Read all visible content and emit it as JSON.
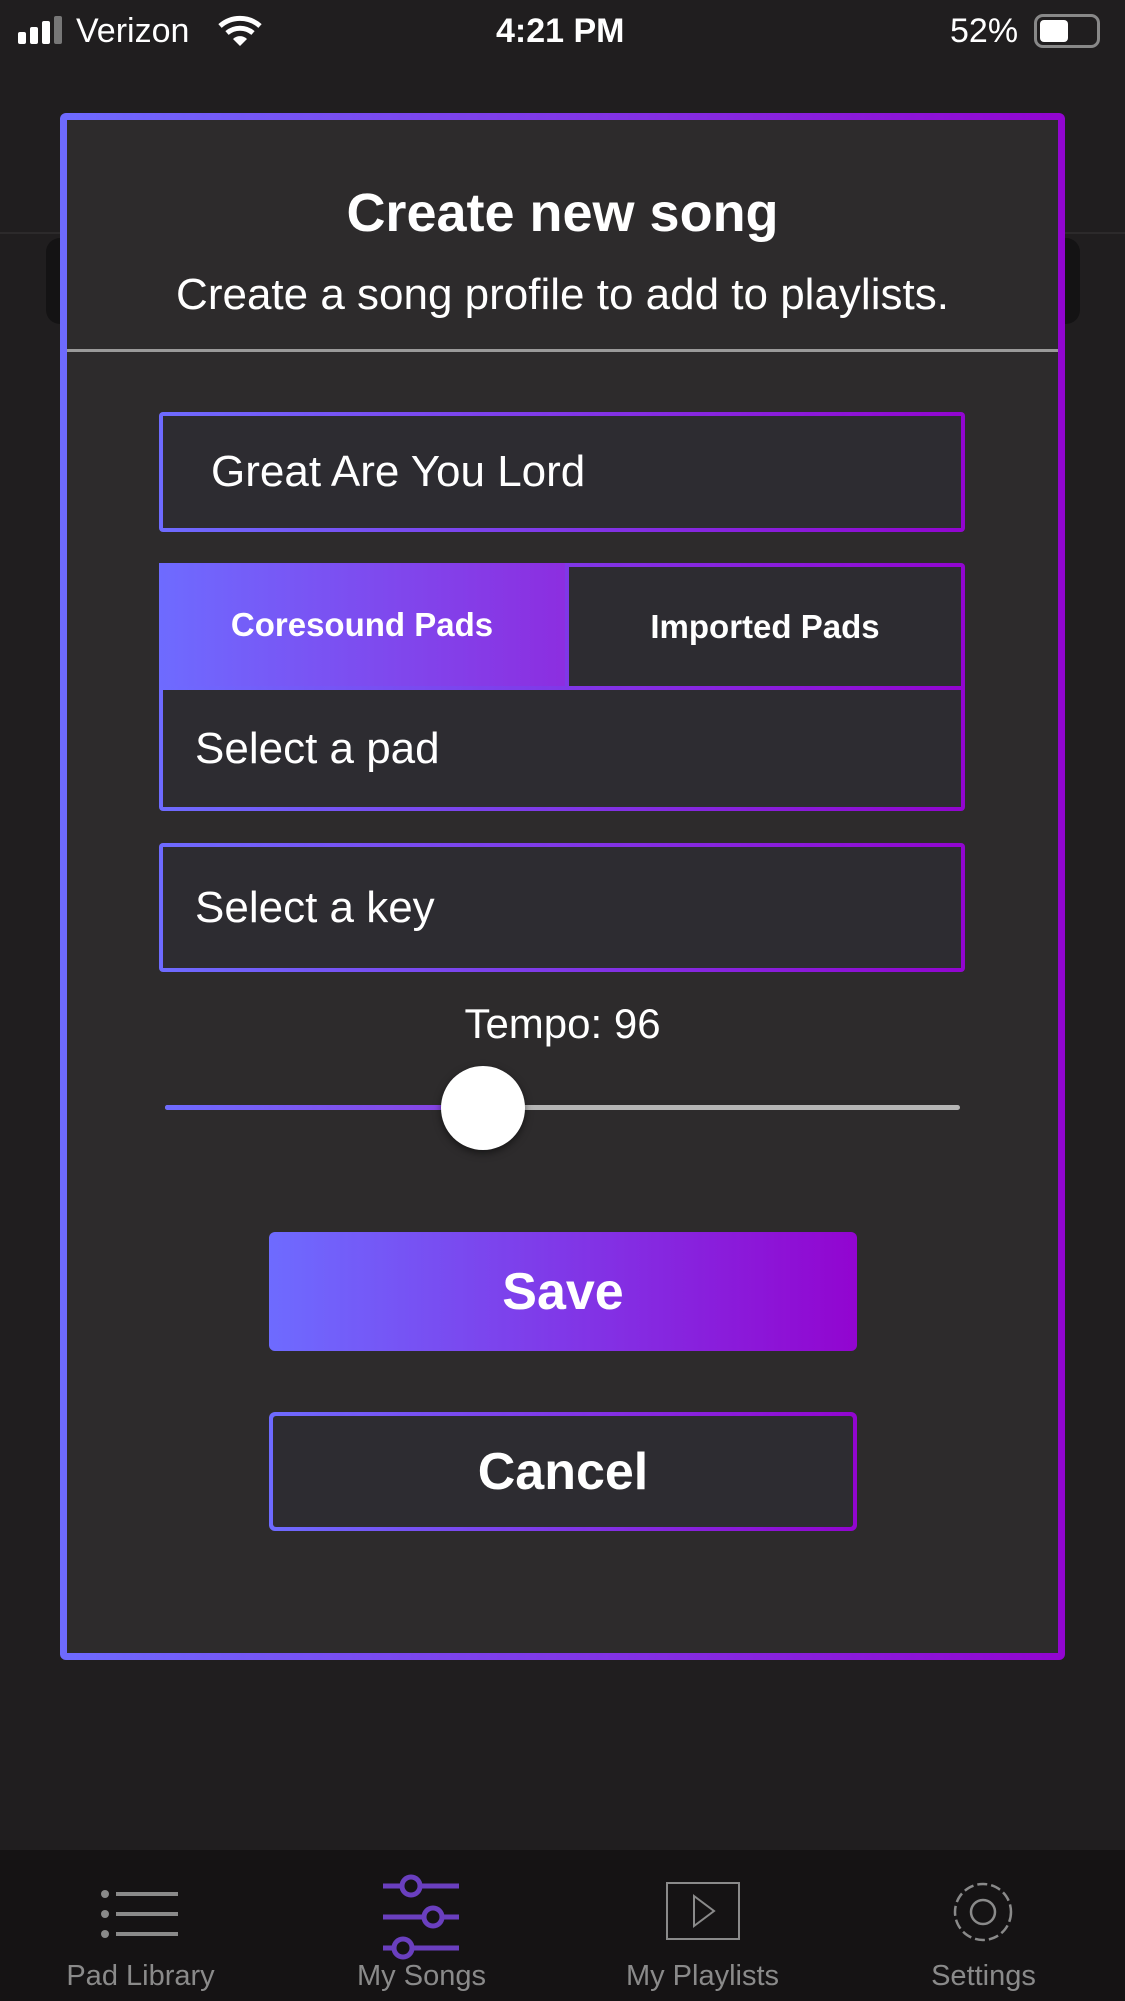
{
  "status": {
    "carrier": "Verizon",
    "time": "4:21 PM",
    "battery": "52%",
    "battery_level": 0.52
  },
  "modal": {
    "title": "Create new song",
    "subtitle": "Create a song profile to add to playlists.",
    "song_name_value": "Great Are You Lord",
    "tabs": [
      {
        "label": "Coresound Pads",
        "active": true
      },
      {
        "label": "Imported Pads",
        "active": false
      }
    ],
    "pad_select": "Select a pad",
    "key_select": "Select a key",
    "tempo_label": "Tempo: 96",
    "tempo_slider_fraction": 0.4,
    "save_label": "Save",
    "cancel_label": "Cancel"
  },
  "colors": {
    "gradient_start": "#6e6bff",
    "gradient_end": "#9205d0",
    "active_tab_icon": "#6a3fbf"
  },
  "tabbar": {
    "items": [
      {
        "label": "Pad Library",
        "icon": "list-icon",
        "active": false
      },
      {
        "label": "My Songs",
        "icon": "sliders-icon",
        "active": true
      },
      {
        "label": "My Playlists",
        "icon": "play-square-icon",
        "active": false
      },
      {
        "label": "Settings",
        "icon": "gear-icon",
        "active": false
      }
    ]
  }
}
